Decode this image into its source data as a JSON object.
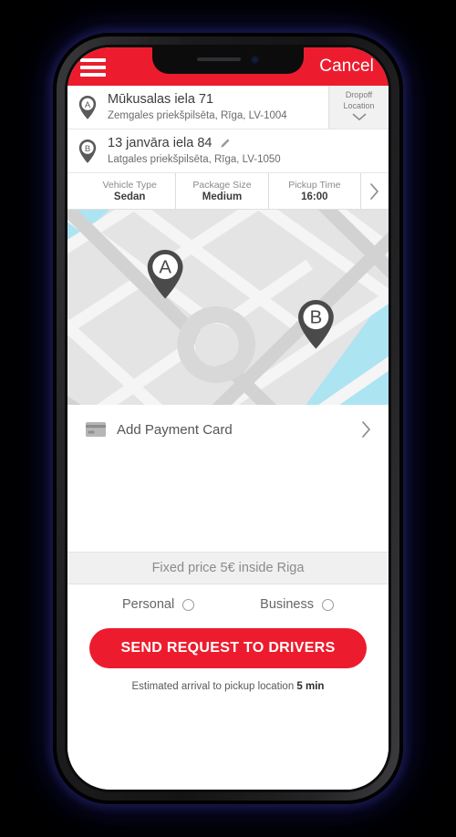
{
  "app": {
    "header": {
      "menu_icon": "hamburger-menu-icon",
      "cancel_label": "Cancel"
    },
    "accent_color": "#EC1C2E",
    "pin_color": "#4A4A4A",
    "water_color": "#ADE4F2"
  },
  "addresses": {
    "pickup": {
      "marker": "A",
      "title": "Mūkusalas iela 71",
      "subtitle": "Zemgales priekšpilsēta, Rīga, LV-1004"
    },
    "dropoff": {
      "marker": "B",
      "title": "13 janvāra iela 84",
      "subtitle": "Latgales priekšpilsēta, Rīga, LV-1050",
      "edit_icon": "pencil-icon"
    },
    "dropoff_toggle": {
      "line1": "Dropoff",
      "line2": "Location",
      "icon": "chevron-down-icon"
    }
  },
  "options": [
    {
      "label": "Vehicle Type",
      "value": "Sedan"
    },
    {
      "label": "Package Size",
      "value": "Medium"
    },
    {
      "label": "Pickup Time",
      "value": "16:00"
    }
  ],
  "options_chevron": "chevron-right-icon",
  "map": {
    "pickup_marker": "A",
    "dropoff_marker": "B"
  },
  "payment": {
    "icon": "credit-card-icon",
    "label": "Add Payment Card",
    "chevron": "chevron-right-icon"
  },
  "fixed_price": {
    "text": "Fixed price 5€ inside Riga"
  },
  "account_types": [
    {
      "label": "Personal",
      "selected": false
    },
    {
      "label": "Business",
      "selected": false
    }
  ],
  "cta": {
    "label": "SEND REQUEST TO DRIVERS"
  },
  "eta": {
    "prefix": "Estimated arrival to pickup location",
    "value": "5 min"
  }
}
